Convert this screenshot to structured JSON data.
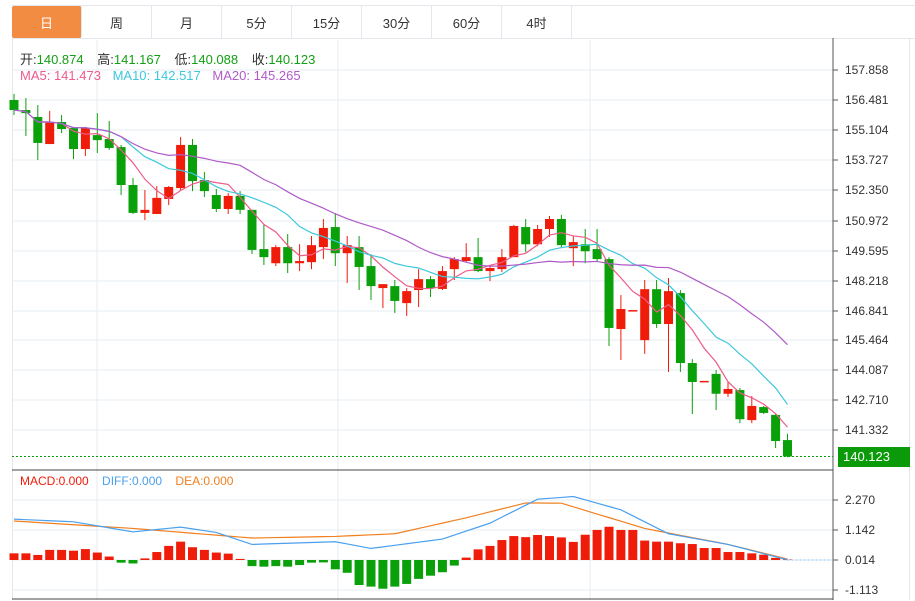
{
  "tabs": [
    {
      "label": "日",
      "active": true
    },
    {
      "label": "周"
    },
    {
      "label": "月"
    },
    {
      "label": "5分"
    },
    {
      "label": "15分"
    },
    {
      "label": "30分"
    },
    {
      "label": "60分"
    },
    {
      "label": "4时"
    }
  ],
  "ohlc": {
    "open_label": "开:",
    "open": "140.874",
    "high_label": "高:",
    "high": "141.167",
    "low_label": "低:",
    "low": "140.088",
    "close_label": "收:",
    "close": "140.123"
  },
  "ma": {
    "ma5": "MA5: 141.473",
    "ma10": "MA10: 142.517",
    "ma20": "MA20: 145.265"
  },
  "macd_legend": {
    "macd": "MACD:0.000",
    "diff": "DIFF:0.000",
    "dea": "DEA:0.000"
  },
  "price_axis": [
    "157.858",
    "156.481",
    "155.104",
    "153.727",
    "152.350",
    "150.972",
    "149.595",
    "148.218",
    "146.841",
    "145.464",
    "144.087",
    "142.710",
    "141.332"
  ],
  "macd_axis": [
    "2.270",
    "1.142",
    "0.014",
    "-1.113"
  ],
  "current_price": "140.123",
  "colors": {
    "up": "#f01c0a",
    "down": "#0aa00a",
    "ma5": "#ee5a8a",
    "ma10": "#3cc8dc",
    "ma20": "#b05ac8",
    "diff": "#4aa0ee",
    "dea": "#f08020",
    "accent": "#f38c43"
  },
  "chart_data": {
    "type": "candlestick",
    "candles": [
      [
        156.48,
        156.76,
        155.79,
        156.02
      ],
      [
        156.02,
        156.57,
        154.83,
        155.88
      ],
      [
        155.7,
        156.25,
        153.73,
        154.51
      ],
      [
        154.46,
        155.98,
        154.46,
        155.47
      ],
      [
        155.47,
        155.79,
        154.96,
        155.15
      ],
      [
        155.2,
        155.25,
        153.77,
        154.23
      ],
      [
        154.23,
        155.25,
        153.91,
        155.2
      ],
      [
        154.87,
        155.88,
        154.05,
        154.64
      ],
      [
        154.69,
        155.52,
        154.19,
        154.28
      ],
      [
        154.32,
        154.42,
        152.12,
        152.58
      ],
      [
        152.58,
        152.9,
        151.25,
        151.3
      ],
      [
        151.3,
        152.35,
        150.97,
        151.44
      ],
      [
        151.25,
        152.53,
        151.25,
        151.99
      ],
      [
        151.94,
        152.53,
        151.66,
        152.49
      ],
      [
        152.44,
        154.78,
        152.35,
        154.42
      ],
      [
        154.42,
        154.69,
        152.3,
        152.76
      ],
      [
        152.81,
        153.18,
        152.03,
        152.3
      ],
      [
        152.12,
        152.4,
        151.34,
        151.48
      ],
      [
        151.48,
        152.21,
        151.25,
        152.08
      ],
      [
        152.08,
        152.3,
        151.25,
        151.44
      ],
      [
        151.44,
        151.44,
        149.41,
        149.6
      ],
      [
        149.64,
        150.75,
        148.91,
        149.27
      ],
      [
        148.99,
        149.82,
        148.86,
        149.73
      ],
      [
        149.73,
        150.33,
        148.54,
        148.99
      ],
      [
        148.99,
        149.86,
        148.63,
        149.09
      ],
      [
        149.04,
        150.24,
        148.72,
        149.82
      ],
      [
        149.73,
        151.02,
        149.18,
        150.61
      ],
      [
        150.65,
        151.29,
        148.86,
        149.45
      ],
      [
        149.45,
        150.24,
        148.08,
        149.82
      ],
      [
        149.73,
        150.24,
        147.76,
        148.82
      ],
      [
        148.86,
        149.41,
        147.3,
        147.94
      ],
      [
        147.85,
        148.03,
        146.93,
        148.03
      ],
      [
        147.94,
        148.22,
        146.71,
        147.26
      ],
      [
        147.16,
        147.85,
        146.57,
        147.71
      ],
      [
        147.76,
        148.72,
        146.98,
        148.26
      ],
      [
        148.26,
        148.4,
        147.44,
        147.85
      ],
      [
        147.81,
        148.86,
        147.76,
        148.63
      ],
      [
        148.72,
        149.27,
        148.22,
        149.18
      ],
      [
        149.09,
        149.91,
        149.05,
        149.27
      ],
      [
        149.27,
        150.15,
        148.58,
        148.63
      ],
      [
        148.63,
        148.91,
        148.17,
        148.77
      ],
      [
        148.72,
        149.64,
        148.58,
        149.27
      ],
      [
        149.27,
        150.75,
        149.27,
        150.7
      ],
      [
        150.65,
        151.02,
        149.5,
        149.86
      ],
      [
        149.86,
        150.75,
        149.77,
        150.56
      ],
      [
        150.56,
        151.16,
        150.2,
        151.02
      ],
      [
        151.02,
        151.21,
        149.68,
        149.82
      ],
      [
        149.68,
        150.24,
        148.86,
        149.96
      ],
      [
        149.86,
        150.56,
        148.99,
        149.54
      ],
      [
        149.64,
        150.56,
        149.09,
        149.18
      ],
      [
        149.18,
        149.27,
        145.19,
        146.02
      ],
      [
        145.97,
        147.53,
        144.55,
        146.89
      ],
      [
        146.84,
        146.84,
        146.84,
        146.84
      ],
      [
        145.46,
        148.22,
        144.83,
        147.8
      ],
      [
        147.8,
        148.22,
        146.02,
        146.2
      ],
      [
        146.2,
        148.31,
        144.0,
        147.71
      ],
      [
        147.62,
        147.76,
        144.0,
        144.41
      ],
      [
        144.41,
        144.59,
        142.07,
        143.54
      ],
      [
        143.59,
        143.59,
        143.59,
        143.59
      ],
      [
        143.91,
        144.09,
        142.25,
        143.0
      ],
      [
        143.0,
        143.54,
        142.85,
        143.22
      ],
      [
        143.17,
        143.27,
        141.65,
        141.83
      ],
      [
        141.79,
        142.9,
        141.65,
        142.44
      ],
      [
        142.39,
        142.44,
        142.07,
        142.12
      ],
      [
        142.03,
        142.07,
        140.51,
        140.83
      ],
      [
        140.874,
        141.167,
        140.088,
        140.123
      ]
    ],
    "ylim": [
      139.6,
      158.3
    ],
    "macd_hist": [
      0.25,
      0.25,
      0.19,
      0.38,
      0.38,
      0.35,
      0.41,
      0.28,
      0.13,
      -0.1,
      -0.13,
      0.06,
      0.3,
      0.53,
      0.69,
      0.48,
      0.38,
      0.28,
      0.24,
      0.04,
      -0.23,
      -0.25,
      -0.23,
      -0.25,
      -0.19,
      -0.1,
      -0.09,
      -0.35,
      -0.48,
      -0.94,
      -1.0,
      -1.08,
      -1.0,
      -0.9,
      -0.71,
      -0.59,
      -0.46,
      -0.21,
      0.09,
      0.4,
      0.53,
      0.75,
      0.9,
      0.86,
      0.94,
      0.9,
      0.85,
      0.68,
      0.95,
      1.13,
      1.25,
      1.13,
      1.13,
      0.73,
      0.69,
      0.69,
      0.63,
      0.6,
      0.45,
      0.45,
      0.3,
      0.3,
      0.25,
      0.2,
      0.08,
      0.02
    ],
    "diff_points": [
      [
        0,
        1.55
      ],
      [
        5,
        1.45
      ],
      [
        10,
        1.07
      ],
      [
        14,
        1.25
      ],
      [
        17,
        1.05
      ],
      [
        20,
        0.6
      ],
      [
        27,
        0.7
      ],
      [
        30,
        0.45
      ],
      [
        36,
        0.8
      ],
      [
        40,
        1.4
      ],
      [
        44,
        2.3
      ],
      [
        47,
        2.4
      ],
      [
        51,
        1.9
      ],
      [
        55,
        1.0
      ],
      [
        60,
        0.6
      ],
      [
        65,
        0.02
      ]
    ],
    "dea_points": [
      [
        0,
        1.48
      ],
      [
        10,
        1.2
      ],
      [
        20,
        0.84
      ],
      [
        27,
        0.9
      ],
      [
        32,
        1.0
      ],
      [
        38,
        1.6
      ],
      [
        43,
        2.16
      ],
      [
        46,
        2.15
      ],
      [
        53,
        1.2
      ],
      [
        60,
        0.6
      ],
      [
        65,
        0.05
      ]
    ],
    "macd_ylim": [
      -1.3,
      2.8
    ]
  }
}
